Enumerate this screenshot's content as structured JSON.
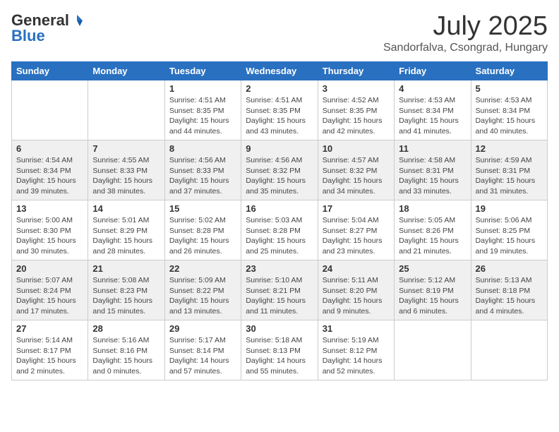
{
  "header": {
    "logo_general": "General",
    "logo_blue": "Blue",
    "month": "July 2025",
    "location": "Sandorfalva, Csongrad, Hungary"
  },
  "days_of_week": [
    "Sunday",
    "Monday",
    "Tuesday",
    "Wednesday",
    "Thursday",
    "Friday",
    "Saturday"
  ],
  "weeks": [
    [
      {
        "day": "",
        "content": ""
      },
      {
        "day": "",
        "content": ""
      },
      {
        "day": "1",
        "content": "Sunrise: 4:51 AM\nSunset: 8:35 PM\nDaylight: 15 hours and 44 minutes."
      },
      {
        "day": "2",
        "content": "Sunrise: 4:51 AM\nSunset: 8:35 PM\nDaylight: 15 hours and 43 minutes."
      },
      {
        "day": "3",
        "content": "Sunrise: 4:52 AM\nSunset: 8:35 PM\nDaylight: 15 hours and 42 minutes."
      },
      {
        "day": "4",
        "content": "Sunrise: 4:53 AM\nSunset: 8:34 PM\nDaylight: 15 hours and 41 minutes."
      },
      {
        "day": "5",
        "content": "Sunrise: 4:53 AM\nSunset: 8:34 PM\nDaylight: 15 hours and 40 minutes."
      }
    ],
    [
      {
        "day": "6",
        "content": "Sunrise: 4:54 AM\nSunset: 8:34 PM\nDaylight: 15 hours and 39 minutes."
      },
      {
        "day": "7",
        "content": "Sunrise: 4:55 AM\nSunset: 8:33 PM\nDaylight: 15 hours and 38 minutes."
      },
      {
        "day": "8",
        "content": "Sunrise: 4:56 AM\nSunset: 8:33 PM\nDaylight: 15 hours and 37 minutes."
      },
      {
        "day": "9",
        "content": "Sunrise: 4:56 AM\nSunset: 8:32 PM\nDaylight: 15 hours and 35 minutes."
      },
      {
        "day": "10",
        "content": "Sunrise: 4:57 AM\nSunset: 8:32 PM\nDaylight: 15 hours and 34 minutes."
      },
      {
        "day": "11",
        "content": "Sunrise: 4:58 AM\nSunset: 8:31 PM\nDaylight: 15 hours and 33 minutes."
      },
      {
        "day": "12",
        "content": "Sunrise: 4:59 AM\nSunset: 8:31 PM\nDaylight: 15 hours and 31 minutes."
      }
    ],
    [
      {
        "day": "13",
        "content": "Sunrise: 5:00 AM\nSunset: 8:30 PM\nDaylight: 15 hours and 30 minutes."
      },
      {
        "day": "14",
        "content": "Sunrise: 5:01 AM\nSunset: 8:29 PM\nDaylight: 15 hours and 28 minutes."
      },
      {
        "day": "15",
        "content": "Sunrise: 5:02 AM\nSunset: 8:28 PM\nDaylight: 15 hours and 26 minutes."
      },
      {
        "day": "16",
        "content": "Sunrise: 5:03 AM\nSunset: 8:28 PM\nDaylight: 15 hours and 25 minutes."
      },
      {
        "day": "17",
        "content": "Sunrise: 5:04 AM\nSunset: 8:27 PM\nDaylight: 15 hours and 23 minutes."
      },
      {
        "day": "18",
        "content": "Sunrise: 5:05 AM\nSunset: 8:26 PM\nDaylight: 15 hours and 21 minutes."
      },
      {
        "day": "19",
        "content": "Sunrise: 5:06 AM\nSunset: 8:25 PM\nDaylight: 15 hours and 19 minutes."
      }
    ],
    [
      {
        "day": "20",
        "content": "Sunrise: 5:07 AM\nSunset: 8:24 PM\nDaylight: 15 hours and 17 minutes."
      },
      {
        "day": "21",
        "content": "Sunrise: 5:08 AM\nSunset: 8:23 PM\nDaylight: 15 hours and 15 minutes."
      },
      {
        "day": "22",
        "content": "Sunrise: 5:09 AM\nSunset: 8:22 PM\nDaylight: 15 hours and 13 minutes."
      },
      {
        "day": "23",
        "content": "Sunrise: 5:10 AM\nSunset: 8:21 PM\nDaylight: 15 hours and 11 minutes."
      },
      {
        "day": "24",
        "content": "Sunrise: 5:11 AM\nSunset: 8:20 PM\nDaylight: 15 hours and 9 minutes."
      },
      {
        "day": "25",
        "content": "Sunrise: 5:12 AM\nSunset: 8:19 PM\nDaylight: 15 hours and 6 minutes."
      },
      {
        "day": "26",
        "content": "Sunrise: 5:13 AM\nSunset: 8:18 PM\nDaylight: 15 hours and 4 minutes."
      }
    ],
    [
      {
        "day": "27",
        "content": "Sunrise: 5:14 AM\nSunset: 8:17 PM\nDaylight: 15 hours and 2 minutes."
      },
      {
        "day": "28",
        "content": "Sunrise: 5:16 AM\nSunset: 8:16 PM\nDaylight: 15 hours and 0 minutes."
      },
      {
        "day": "29",
        "content": "Sunrise: 5:17 AM\nSunset: 8:14 PM\nDaylight: 14 hours and 57 minutes."
      },
      {
        "day": "30",
        "content": "Sunrise: 5:18 AM\nSunset: 8:13 PM\nDaylight: 14 hours and 55 minutes."
      },
      {
        "day": "31",
        "content": "Sunrise: 5:19 AM\nSunset: 8:12 PM\nDaylight: 14 hours and 52 minutes."
      },
      {
        "day": "",
        "content": ""
      },
      {
        "day": "",
        "content": ""
      }
    ]
  ]
}
